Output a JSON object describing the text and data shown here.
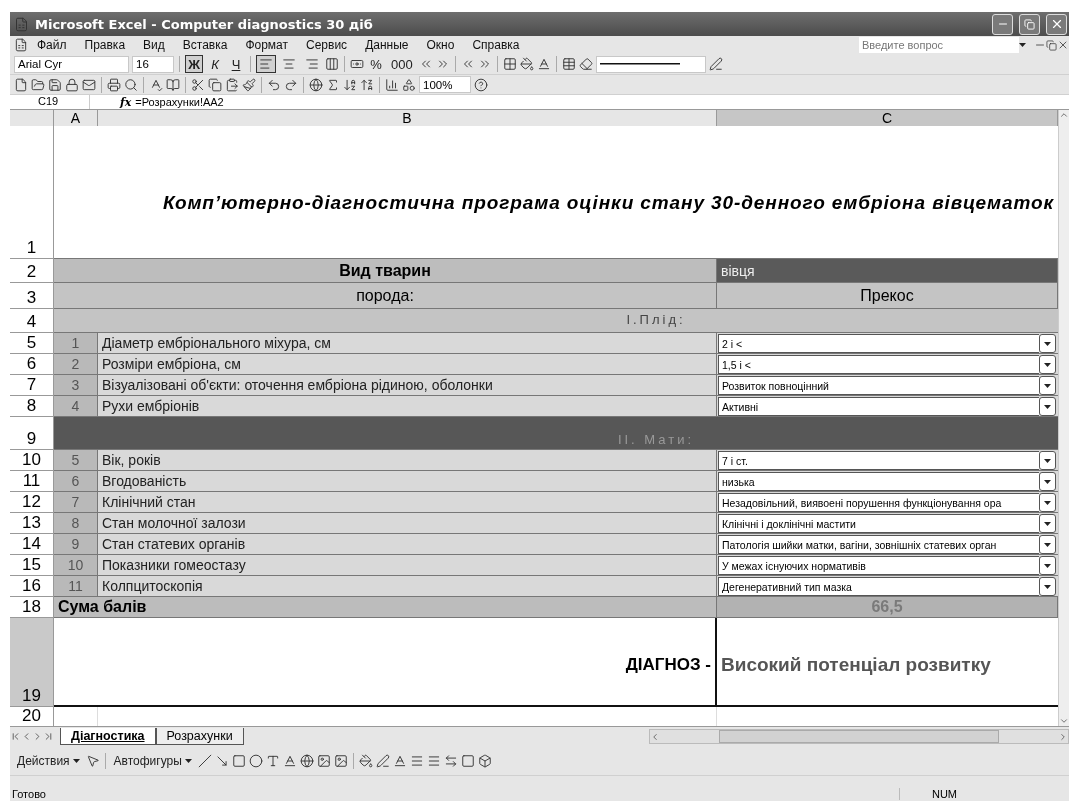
{
  "window": {
    "title": "Microsoft Excel - Computer diagnostics 30 діб"
  },
  "menu": [
    "Файл",
    "Правка",
    "Вид",
    "Вставка",
    "Формат",
    "Сервис",
    "Данные",
    "Окно",
    "Справка"
  ],
  "help_box": {
    "placeholder": "Введите вопрос"
  },
  "format_toolbar": {
    "font": "Arial Cyr",
    "size": "16",
    "align_buttons": [
      {
        "pressed": true
      },
      {
        "pressed": false
      },
      {
        "pressed": false
      }
    ],
    "style_buttons": [
      {
        "label": "Ж",
        "pressed": true
      },
      {
        "label": "К",
        "pressed": false
      },
      {
        "label": "Ч",
        "pressed": false
      }
    ],
    "number_buttons": [
      "%",
      "000"
    ]
  },
  "standard_toolbar": {
    "zoom": "100%"
  },
  "formula_bar": {
    "name_box": "C19",
    "fx": "fx",
    "formula": "=Розрахунки!AA2"
  },
  "columns": [
    {
      "label": "A",
      "selected": false
    },
    {
      "label": "B",
      "selected": false
    },
    {
      "label": "C",
      "selected": true
    }
  ],
  "rows": [
    {
      "num": "1",
      "kind": "title",
      "selected": false,
      "text": "Комп’ютерно-діагностична програма оцінки стану 30-денного ембріона вівцематок"
    },
    {
      "num": "2",
      "kind": "pair_dark",
      "selected": false,
      "label": "Вид тварин",
      "value": "вівця"
    },
    {
      "num": "3",
      "kind": "pair_light",
      "selected": false,
      "label": "порода:",
      "value": "Прекос"
    },
    {
      "num": "4",
      "kind": "section",
      "selected": false,
      "dark": false,
      "text": "І.Плід:"
    },
    {
      "num": "5",
      "kind": "question",
      "selected": false,
      "index": "1",
      "text": "Діаметр ембріонального міхура, см",
      "answer": "2 і <"
    },
    {
      "num": "6",
      "kind": "question",
      "selected": false,
      "index": "2",
      "text": "Розміри ембріона, см",
      "answer": "1,5 і <"
    },
    {
      "num": "7",
      "kind": "question",
      "selected": false,
      "index": "3",
      "text": "Візуалізовані об'єкти: оточення ембріона рідиною, оболонки",
      "answer": "Розвиток повноцінний"
    },
    {
      "num": "8",
      "kind": "question",
      "selected": false,
      "index": "4",
      "text": "Рухи ембріонів",
      "answer": "Активні"
    },
    {
      "num": "9",
      "kind": "section",
      "selected": false,
      "dark": true,
      "text": "ІІ. Мати:"
    },
    {
      "num": "10",
      "kind": "question",
      "selected": false,
      "index": "5",
      "text": "Вік, років",
      "answer": "7 і ст."
    },
    {
      "num": "11",
      "kind": "question",
      "selected": false,
      "index": "6",
      "text": "Вгодованість",
      "answer": "низька"
    },
    {
      "num": "12",
      "kind": "question",
      "selected": false,
      "index": "7",
      "text": "Клінічний стан",
      "answer": "Незадовільний, виявоені порушення функціонування ора"
    },
    {
      "num": "13",
      "kind": "question",
      "selected": false,
      "index": "8",
      "text": "Стан молочної залози",
      "answer": "Клінічні і доклінічні мастити"
    },
    {
      "num": "14",
      "kind": "question",
      "selected": false,
      "index": "9",
      "text": "Стан статевих органів",
      "answer": "Патологія шийки матки, вагіни, зовнішніх статевих орган"
    },
    {
      "num": "15",
      "kind": "question",
      "selected": false,
      "index": "10",
      "text": "Показники гомеостазу",
      "answer": "У межах існуючих нормативів"
    },
    {
      "num": "16",
      "kind": "question",
      "selected": false,
      "index": "11",
      "text": "Колпцитоскопія",
      "answer": "Дегенеративний тип мазка"
    },
    {
      "num": "18",
      "kind": "total",
      "selected": false,
      "caption": "Сума балів",
      "score": "66,5"
    },
    {
      "num": "19",
      "kind": "diagnosis",
      "selected": true,
      "diagnosis_label": "ДІАГНОЗ -",
      "diagnosis": "Високий потенціал розвитку"
    },
    {
      "num": "20",
      "kind": "blank",
      "selected": false
    }
  ],
  "sheet_tabs": [
    {
      "label": "Діагностика",
      "selected": true
    },
    {
      "label": "Розрахунки",
      "selected": false
    }
  ],
  "drawing_toolbar": {
    "actions": "Действия",
    "autoshapes": "Автофигуры"
  },
  "status_bar": {
    "text": "Готово",
    "indicator": "NUM"
  }
}
